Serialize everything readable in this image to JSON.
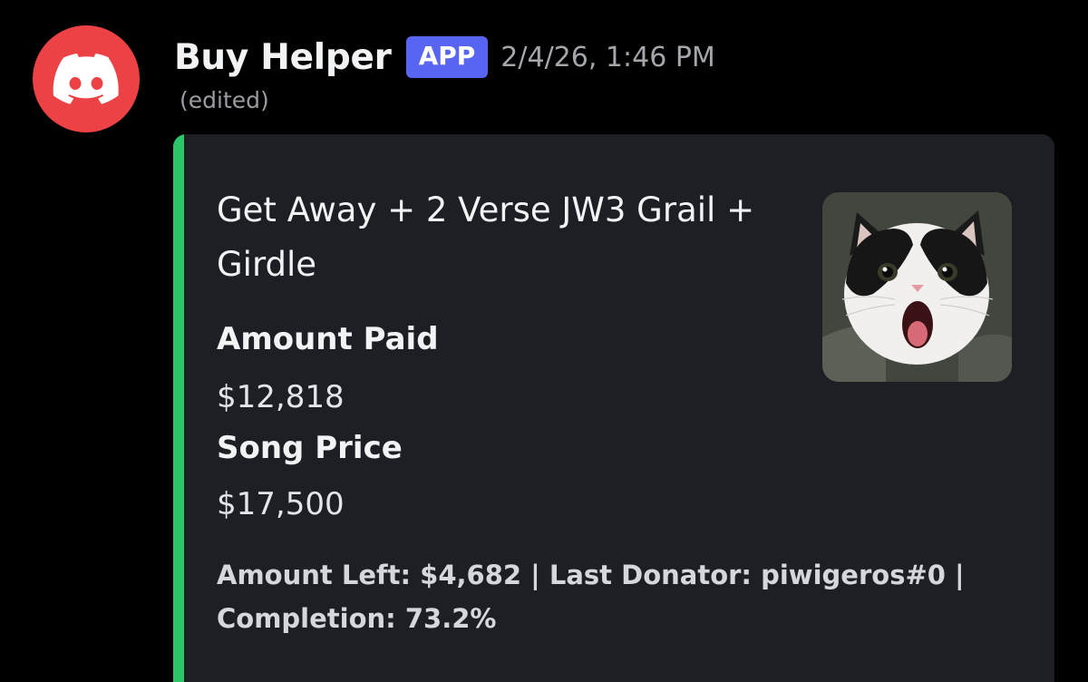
{
  "message": {
    "author": "Buy Helper",
    "badge": "APP",
    "timestamp": "2/4/26, 1:46 PM",
    "edited_label": "(edited)",
    "avatar_icon": "discord-logo-icon",
    "avatar_color": "#ed4245"
  },
  "embed": {
    "accent_color": "#2bc56a",
    "title": "Get Away + 2 Verse JW3 Grail + Girdle",
    "fields": [
      {
        "name": "Amount Paid",
        "value": "$12,818"
      },
      {
        "name": "Song Price",
        "value": "$17,500"
      }
    ],
    "footer": "Amount Left: $4,682 | Last Donator: piwigeros#0 | Completion: 73.2%",
    "thumbnail_icon": "shocked-cat-thumbnail"
  }
}
